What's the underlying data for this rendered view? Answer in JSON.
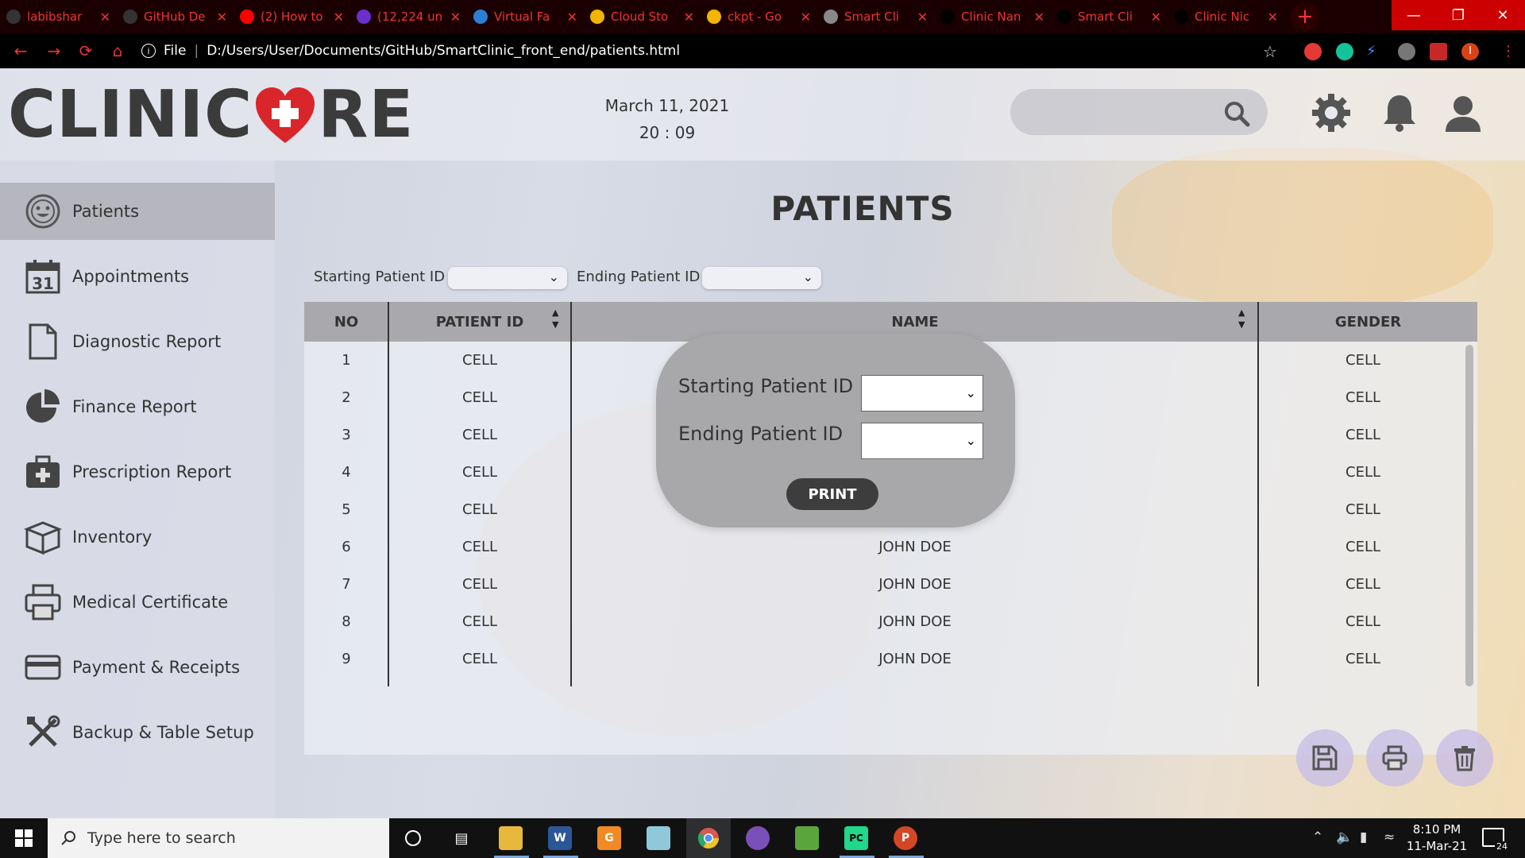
{
  "browser": {
    "tabs": [
      {
        "title": "labibshar",
        "favicon": "github-icon",
        "color": "#333333"
      },
      {
        "title": "GitHub De",
        "favicon": "github-icon",
        "color": "#333333"
      },
      {
        "title": "(2) How to",
        "favicon": "youtube-icon",
        "color": "#ff0000"
      },
      {
        "title": "(12,224 un",
        "favicon": "mail-icon",
        "color": "#6b2fcf"
      },
      {
        "title": "Virtual Fa",
        "favicon": "site-icon",
        "color": "#2a7fd5"
      },
      {
        "title": "Cloud Sto",
        "favicon": "drive-icon",
        "color": "#f4b400"
      },
      {
        "title": "ckpt - Go",
        "favicon": "drive-icon",
        "color": "#f4b400"
      },
      {
        "title": "Smart Cli",
        "favicon": "globe-icon",
        "color": "#888888"
      },
      {
        "title": "Clinic Nan",
        "favicon": "none",
        "color": "#000000"
      },
      {
        "title": "Smart Cli",
        "favicon": "none",
        "color": "#000000"
      },
      {
        "title": "Clinic Nic",
        "favicon": "none",
        "color": "#000000"
      }
    ],
    "new_tab": "+",
    "address_scheme": "File",
    "url": "D:/Users/User/Documents/GitHub/SmartClinic_front_end/patients.html",
    "accent": "#e53935"
  },
  "header": {
    "logo_left": "CLINIC",
    "logo_right": "RE",
    "date": "March 11, 2021",
    "time": "20 : 09",
    "search_placeholder": ""
  },
  "sidebar": {
    "items": [
      {
        "label": "Patients",
        "icon": "smiley-icon",
        "active": true
      },
      {
        "label": "Appointments",
        "icon": "calendar-icon",
        "active": false
      },
      {
        "label": "Diagnostic Report",
        "icon": "document-icon",
        "active": false
      },
      {
        "label": "Finance Report",
        "icon": "pie-chart-icon",
        "active": false
      },
      {
        "label": "Prescription Report",
        "icon": "medical-bag-icon",
        "active": false
      },
      {
        "label": "Inventory",
        "icon": "box-icon",
        "active": false
      },
      {
        "label": "Medical Certificate",
        "icon": "printer-icon",
        "active": false
      },
      {
        "label": "Payment & Receipts",
        "icon": "card-icon",
        "active": false
      },
      {
        "label": "Backup & Table Setup",
        "icon": "tools-icon",
        "active": false
      }
    ]
  },
  "main": {
    "title": "PATIENTS",
    "filter": {
      "start_label": "Starting Patient ID",
      "end_label": "Ending Patient ID",
      "start_value": "",
      "end_value": ""
    },
    "table": {
      "columns": [
        "NO",
        "PATIENT ID",
        "NAME",
        "GENDER"
      ],
      "rows": [
        {
          "no": "1",
          "pid": "CELL",
          "name": "",
          "gender": "CELL"
        },
        {
          "no": "2",
          "pid": "CELL",
          "name": "",
          "gender": "CELL"
        },
        {
          "no": "3",
          "pid": "CELL",
          "name": "",
          "gender": "CELL"
        },
        {
          "no": "4",
          "pid": "CELL",
          "name": "",
          "gender": "CELL"
        },
        {
          "no": "5",
          "pid": "CELL",
          "name": "",
          "gender": "CELL"
        },
        {
          "no": "6",
          "pid": "CELL",
          "name": "JOHN DOE",
          "gender": "CELL"
        },
        {
          "no": "7",
          "pid": "CELL",
          "name": "JOHN DOE",
          "gender": "CELL"
        },
        {
          "no": "8",
          "pid": "CELL",
          "name": "JOHN DOE",
          "gender": "CELL"
        },
        {
          "no": "9",
          "pid": "CELL",
          "name": "JOHN DOE",
          "gender": "CELL"
        }
      ]
    },
    "print_dialog": {
      "start_label": "Starting Patient ID",
      "end_label": "Ending Patient ID",
      "start_value": "",
      "end_value": "",
      "button": "PRINT"
    },
    "actions": [
      "save-icon",
      "printer-icon",
      "trash-icon"
    ]
  },
  "taskbar": {
    "search_placeholder": "Type here to search",
    "time": "8:10 PM",
    "date": "11-Mar-21",
    "notifications": "24"
  }
}
